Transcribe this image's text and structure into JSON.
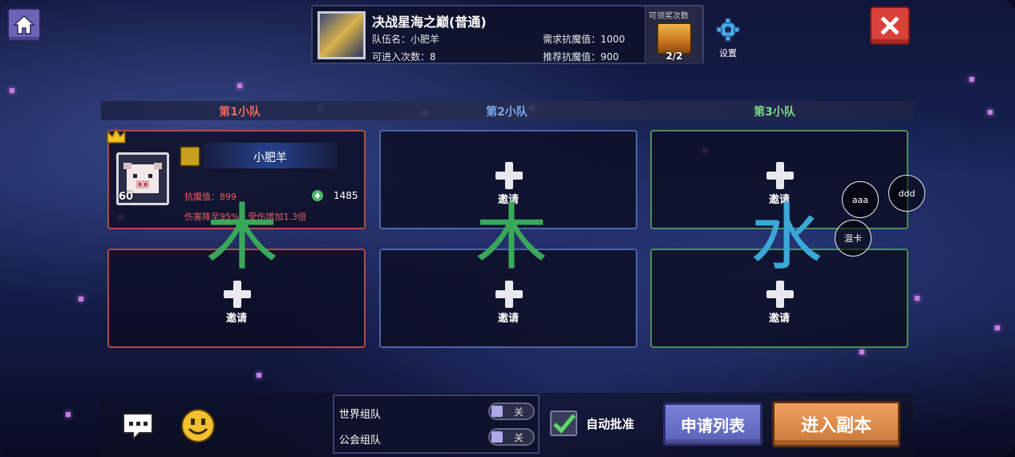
{
  "header": {
    "settings_label": "设置"
  },
  "dungeon": {
    "title": "决战星海之巅(普通)",
    "team_name": "队伍名：小肥羊",
    "entries": "可进入次数：8",
    "required_resistance": "需求抗魔值：1000",
    "recommended_resistance": "推荐抗魔值：900",
    "reward_label": "可领奖次数",
    "reward_count": "2/2"
  },
  "teams": [
    {
      "title": "第1小队",
      "member": {
        "name": "小肥羊",
        "level": "60",
        "resistance": "抗魔值：899",
        "power": "1485",
        "debuff": "伤害降至95%，受伤增加1.3倍"
      }
    },
    {
      "title": "第2小队"
    },
    {
      "title": "第3小队"
    }
  ],
  "slots": {
    "invite": "邀请"
  },
  "elements": [
    "木",
    "木",
    "水"
  ],
  "bubbles": [
    "aaa",
    "ddd",
    "混卡"
  ],
  "toggles": [
    {
      "label": "世界组队",
      "state": "关"
    },
    {
      "label": "公会组队",
      "state": "关"
    }
  ],
  "bottom": {
    "auto_approve": "自动批准",
    "apply_list": "申请列表",
    "enter_dungeon": "进入副本"
  },
  "colors": {
    "team1": "#e86a5a",
    "team2": "#7aa8f0",
    "team3": "#7ad88a",
    "wood": "#3aa85a",
    "water": "#3aa8d8",
    "enter_button": "#e0905a",
    "apply_button": "#6a72c8",
    "close_button": "#d9423a"
  }
}
